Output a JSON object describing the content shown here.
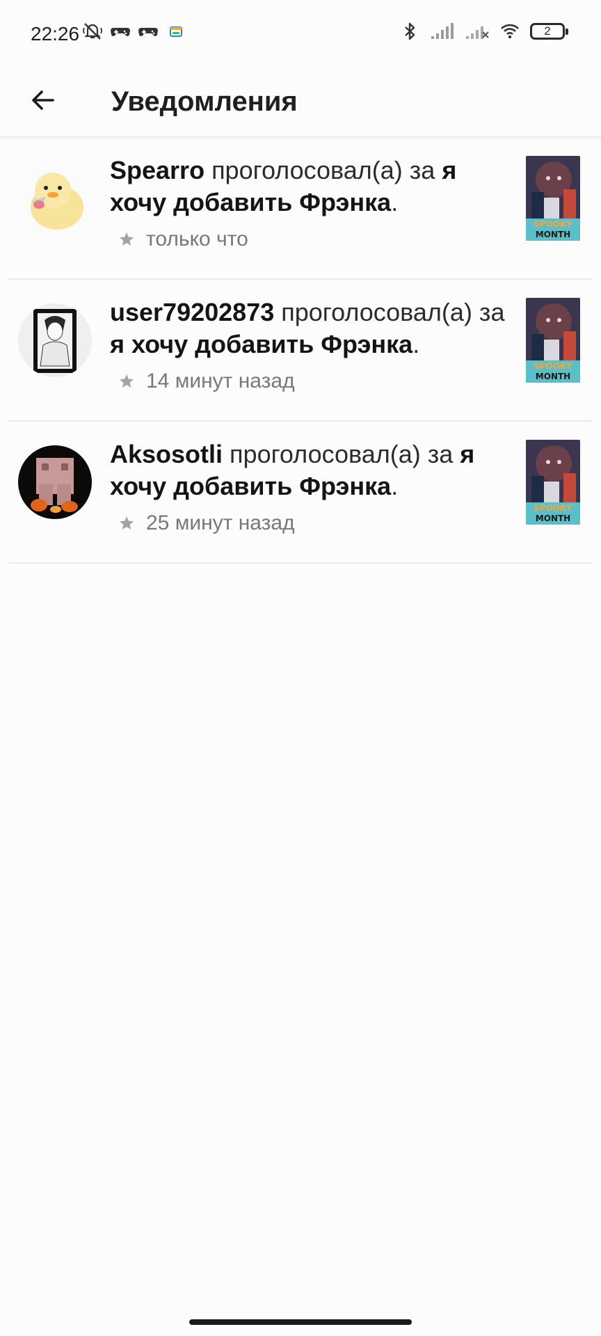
{
  "status_bar": {
    "time": "22:26",
    "left_icons": [
      "mute-icon",
      "gamepad-icon",
      "gamepad-icon",
      "app-icon"
    ],
    "right_icons": [
      "bluetooth-icon",
      "signal-icon",
      "signal-no-service-icon",
      "wifi-icon"
    ],
    "battery": "2"
  },
  "header": {
    "title": "Уведомления",
    "back_icon": "arrow-left-icon"
  },
  "notifications": [
    {
      "user": "Spearro",
      "action": " проголосовал(а) за ",
      "target": "я хочу добавить Фрэнка",
      "suffix": ".",
      "time": "только что"
    },
    {
      "user": "user79202873",
      "action": " проголосовал(а) за ",
      "target": "я хочу добавить Фрэнка",
      "suffix": ".",
      "time": "14 минут назад"
    },
    {
      "user": "Aksosotli",
      "action": " проголосовал(а) за ",
      "target": "я хочу добавить Фрэнка",
      "suffix": ".",
      "time": "25 минут назад"
    }
  ],
  "thumbnail": {
    "line1": "SPOOKY",
    "line2": "MONTH"
  },
  "colors": {
    "background": "#fdfcfd",
    "divider": "#ececef",
    "meta_text": "#77777c",
    "star": "#a3a3a8"
  }
}
